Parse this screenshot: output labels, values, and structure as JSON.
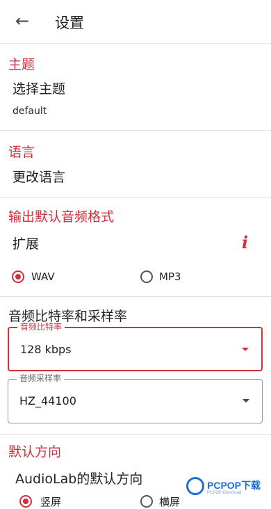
{
  "appbar": {
    "title": "设置"
  },
  "theme": {
    "section": "主题",
    "item": "选择主题",
    "value": "default"
  },
  "language": {
    "section": "语言",
    "item": "更改语言"
  },
  "output": {
    "section": "输出默认音频格式",
    "item": "扩展",
    "formats": [
      {
        "label": "WAV",
        "selected": true
      },
      {
        "label": "MP3",
        "selected": false
      }
    ]
  },
  "rate": {
    "heading": "音频比特率和采样率",
    "bitrate": {
      "label": "音频比特率",
      "value": "128 kbps"
    },
    "samplerate": {
      "label": "音频采样率",
      "value": "HZ_44100"
    }
  },
  "orientation": {
    "section": "默认方向",
    "item": "AudioLab的默认方向",
    "options": [
      {
        "label": "竖屏",
        "selected": true
      },
      {
        "label": "横屏",
        "selected": false
      }
    ]
  },
  "watermark": {
    "brand": "PCPOP下载",
    "tagline": "PCPOP Download"
  },
  "colors": {
    "accent": "#d32f3a",
    "watermark": "#1e6fd9"
  }
}
